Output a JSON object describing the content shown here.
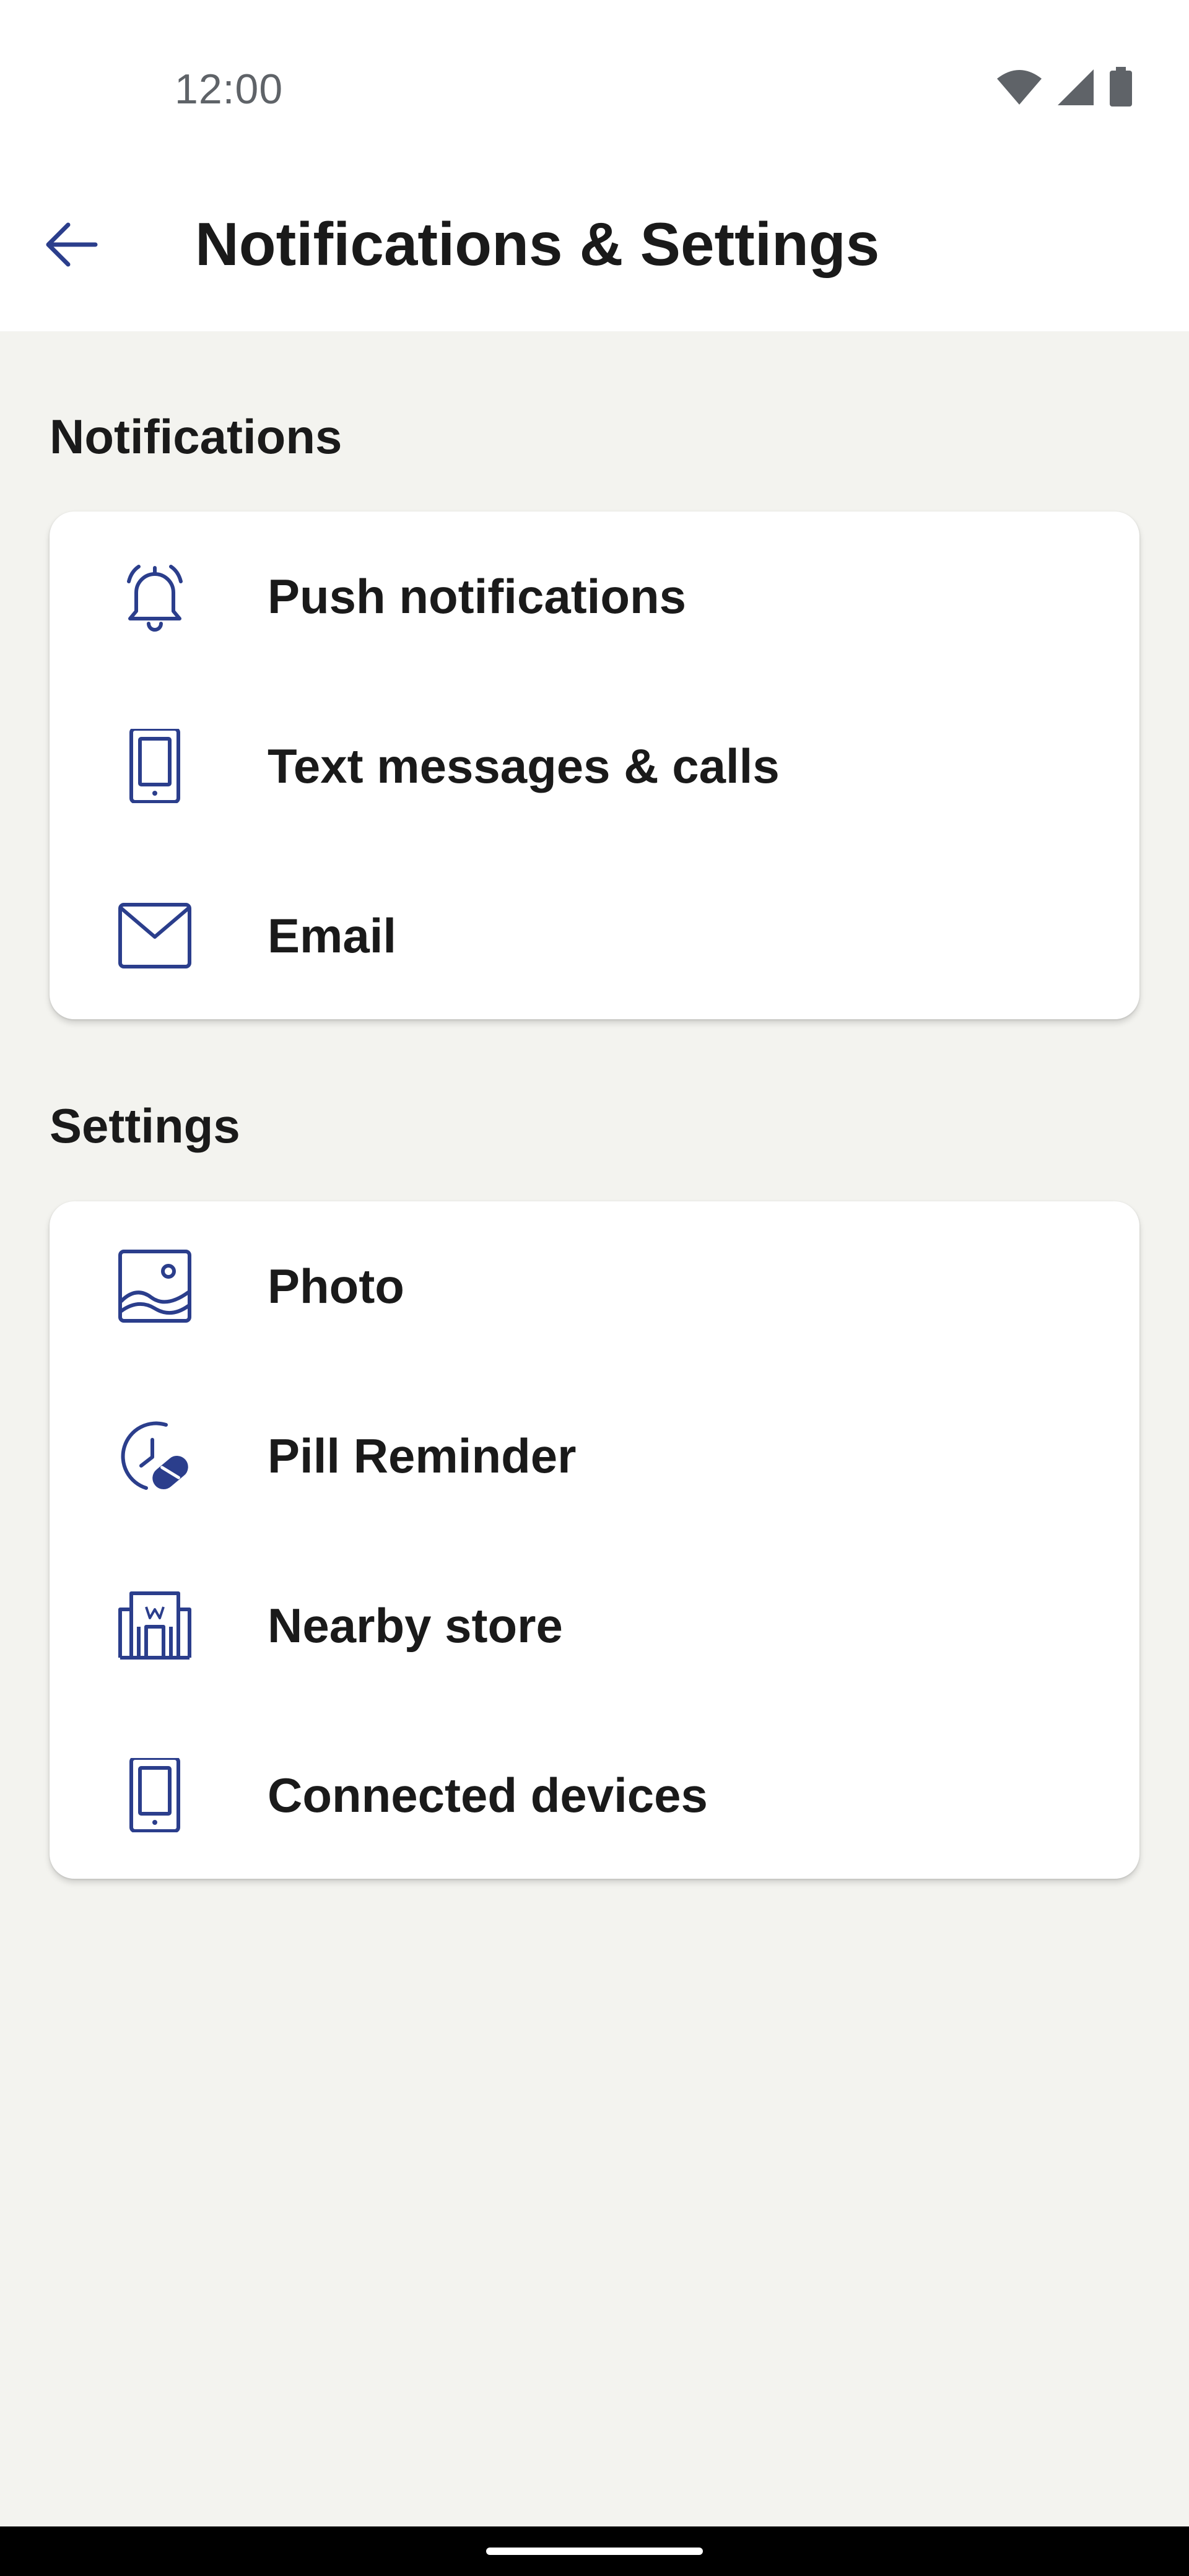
{
  "status_bar": {
    "time": "12:00",
    "icons": [
      "wifi-icon",
      "cellular-signal-icon",
      "battery-icon"
    ]
  },
  "app_bar": {
    "back_icon": "arrow-left-icon",
    "title": "Notifications & Settings"
  },
  "sections": {
    "notifications": {
      "title": "Notifications",
      "items": [
        {
          "label": "Push notifications",
          "icon": "bell-icon"
        },
        {
          "label": "Text messages & calls",
          "icon": "smartphone-icon"
        },
        {
          "label": "Email",
          "icon": "envelope-icon"
        }
      ]
    },
    "settings": {
      "title": "Settings",
      "items": [
        {
          "label": "Photo",
          "icon": "image-icon"
        },
        {
          "label": "Pill Reminder",
          "icon": "clock-pill-icon"
        },
        {
          "label": "Nearby store",
          "icon": "store-icon"
        },
        {
          "label": "Connected devices",
          "icon": "smartphone-icon"
        }
      ]
    }
  },
  "colors": {
    "accent": "#2B3E8C",
    "background": "#F3F3EF",
    "surface": "#FFFFFF",
    "text": "#1A1A1A"
  }
}
